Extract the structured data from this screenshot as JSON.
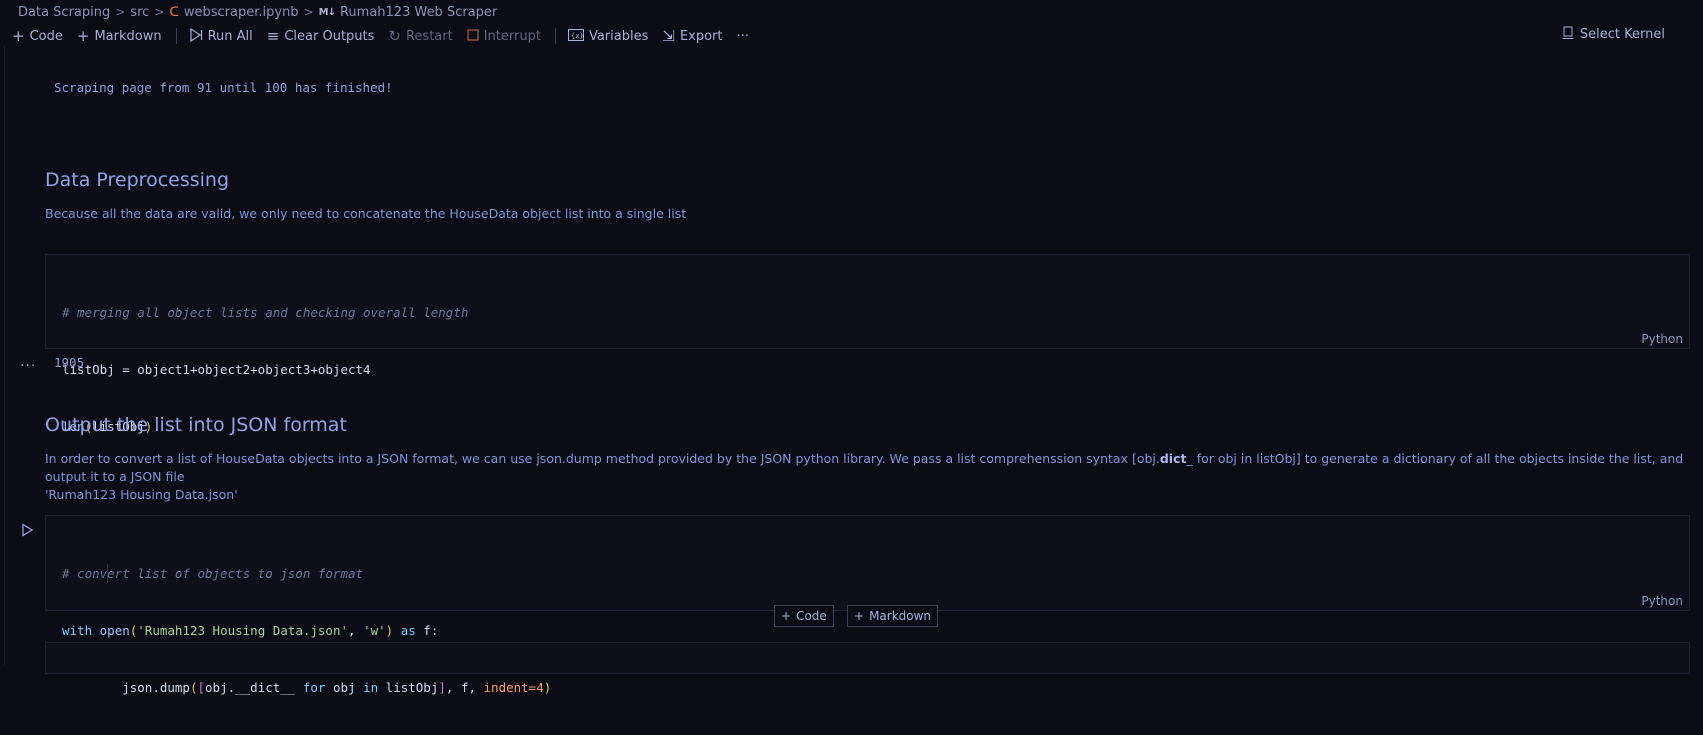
{
  "breadcrumb": {
    "items": [
      "Data Scraping",
      "src",
      "webscraper.ipynb",
      "Rumah123 Web Scraper"
    ],
    "separator": ">",
    "md_prefix": "M↓"
  },
  "toolbar": {
    "code_label": "Code",
    "markdown_label": "Markdown",
    "run_all_label": "Run All",
    "clear_outputs_label": "Clear Outputs",
    "restart_label": "Restart",
    "interrupt_label": "Interrupt",
    "variables_label": "Variables",
    "export_label": "Export",
    "more_label": "···",
    "select_kernel_label": "Select Kernel"
  },
  "cells": {
    "output1": "Scraping page from 91 until 100 has finished!",
    "heading1": "Data Preprocessing",
    "para1": "Because all the data are valid, we only need to concatenate the HouseData object list into a single list",
    "code1": {
      "line1": "# merging all object lists and checking overall length",
      "line2": "listObj = object1+object2+object3+object4",
      "line3_fn": "len",
      "line3_arg": "listObj",
      "language": "Python"
    },
    "output2": "1905",
    "output2_marker": "...",
    "heading2": "Output the list into JSON format",
    "para2_a": "In order to convert a list of HouseData objects into a JSON format, we can use json.dump method provided by the JSON python library. We pass a list comprehenssion syntax [obj.",
    "para2_bold": "dict",
    "para2_b": "_ for obj in listObj] to generate a dictionary of all the objects inside the list, and output it to a JSON file",
    "para2_c": "'Rumah123 Housing Data.json'",
    "code2": {
      "line1": "# convert list of objects to json format",
      "kw_with": "with",
      "fn_open": "open",
      "str_file": "'Rumah123 Housing Data.json'",
      "str_mode": "'w'",
      "kw_as": "as",
      "var_f": "f:",
      "dump": "json.dump",
      "comp": "obj.__dict__",
      "kw_for": "for",
      "obj": "obj",
      "kw_in": "in",
      "listobj": "listObj",
      "tail_f": ", f, ",
      "indent": "indent=4",
      "language": "Python"
    }
  },
  "insert": {
    "code_label": "Code",
    "markdown_label": "Markdown"
  }
}
